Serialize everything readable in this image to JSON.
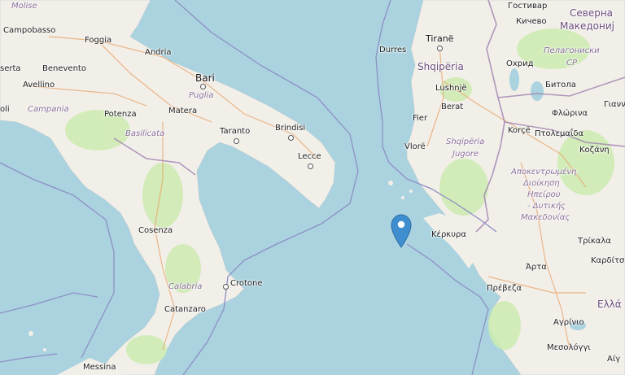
{
  "map": {
    "colors": {
      "sea": "#aad3df",
      "land": "#f2efe9",
      "green": "#cdebb0",
      "border": "#9e7fb0",
      "maritime": "#8d8fc4",
      "road": "#e8a76f",
      "pin": "#3e8ed0"
    },
    "labels": {
      "molise": "Molise",
      "campobasso": "Campobasso",
      "foggia": "Foggia",
      "andria": "Andria",
      "bari": "Bari",
      "puglia": "Puglia",
      "matera": "Matera",
      "taranto": "Taranto",
      "brindisi": "Brindisi",
      "lecce": "Lecce",
      "benevento": "Benevento",
      "serta": "serta",
      "avellino": "Avellino",
      "oli": "oli",
      "campania": "Campania",
      "potenza": "Potenza",
      "basilicata": "Basilicata",
      "cosenza": "Cosenza",
      "calabria": "Calabria",
      "crotone": "Crotone",
      "catanzaro": "Catanzaro",
      "messina": "Messina",
      "tirane": "Tiranë",
      "durres": "Durres",
      "shqiperia": "Shqipëria",
      "lushnje": "Lushnjë",
      "berat": "Berat",
      "fier": "Fier",
      "vlore": "Vlorë",
      "shqiperia_jugore_1": "Shqipëria",
      "shqiperia_jugore_2": "Jugore",
      "korce": "Korçë",
      "kerkyra": "Κέρκυρα",
      "gostivar": "Гостивар",
      "kicevo": "Кичево",
      "severna_1": "Северна",
      "severna_2": "Македониј",
      "pelagoniski_1": "Пелагониски",
      "pelagoniski_2": "СР",
      "ohrid": "Охрид",
      "bitola": "Битола",
      "florina": "Φλώρινα",
      "giann": "Γιαννι",
      "ptolemaida": "Πτολεμαΐδα",
      "kozani": "Κοζάνη",
      "apokentromeni_1": "Αποκεντρωμένη",
      "apokentromeni_2": "Διοίκηση",
      "apokentromeni_3": "Ηπείρου",
      "apokentromeni_4": "- Δυτικής",
      "apokentromeni_5": "Μακεδονίας",
      "trikala": "Τρίκαλα",
      "arta": "Άρτα",
      "karditsa": "Καρδίτσ",
      "preveza": "Πρέβεζα",
      "ellada": "Ελλά",
      "agrinio": "Αγρίνιο",
      "mesolongi": "Μεσολόγγι",
      "aigio": "Αίγ"
    },
    "marker": {
      "name": "earthquake-epicenter"
    }
  }
}
